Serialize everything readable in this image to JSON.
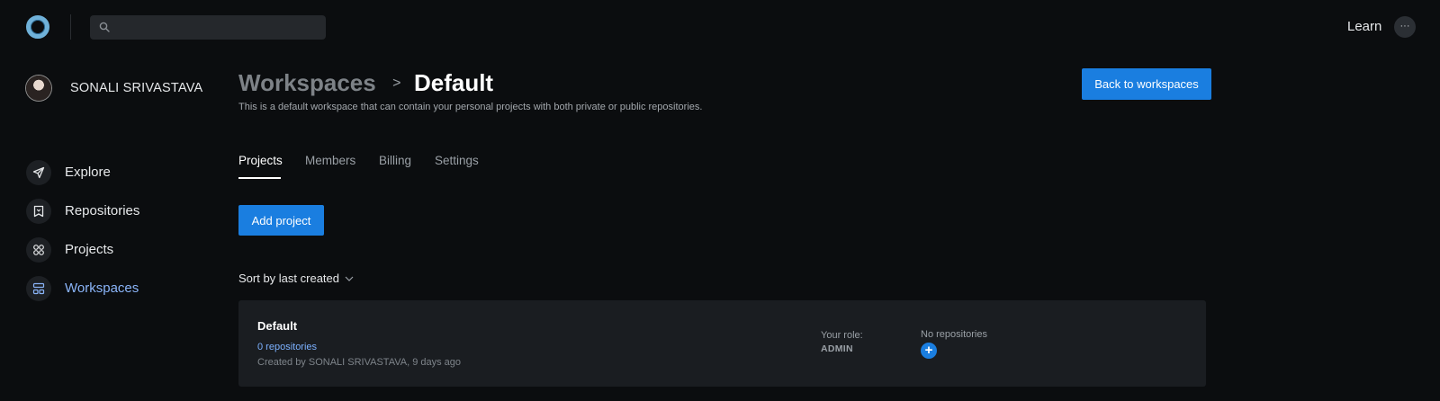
{
  "topbar": {
    "search_placeholder": "",
    "learn_label": "Learn",
    "more_label": "···"
  },
  "user": {
    "name": "SONALI SRIVASTAVA"
  },
  "sidebar": {
    "items": [
      {
        "label": "Explore",
        "icon": "send-icon",
        "active": false
      },
      {
        "label": "Repositories",
        "icon": "repository-icon",
        "active": false
      },
      {
        "label": "Projects",
        "icon": "grid-icon",
        "active": false
      },
      {
        "label": "Workspaces",
        "icon": "workspaces-icon",
        "active": true
      }
    ]
  },
  "header": {
    "breadcrumb_root": "Workspaces",
    "breadcrumb_sep": ">",
    "breadcrumb_current": "Default",
    "subtitle": "This is a default workspace that can contain your personal projects with both private or public repositories.",
    "back_button": "Back to workspaces"
  },
  "tabs": [
    {
      "label": "Projects",
      "active": true
    },
    {
      "label": "Members",
      "active": false
    },
    {
      "label": "Billing",
      "active": false
    },
    {
      "label": "Settings",
      "active": false
    }
  ],
  "actions": {
    "add_project": "Add project"
  },
  "sort": {
    "label": "Sort by last created"
  },
  "project_card": {
    "title": "Default",
    "repos_link": "0 repositories",
    "created": "Created by SONALI SRIVASTAVA, 9 days ago",
    "role_label": "Your role:",
    "role_value": "ADMIN",
    "no_repos": "No repositories",
    "add_repo": "+"
  },
  "colors": {
    "background": "#0b0d0f",
    "accent": "#1a7ee0",
    "active_nav": "#8ab4f8",
    "card": "#1a1d21",
    "link": "#7cb1ff"
  }
}
